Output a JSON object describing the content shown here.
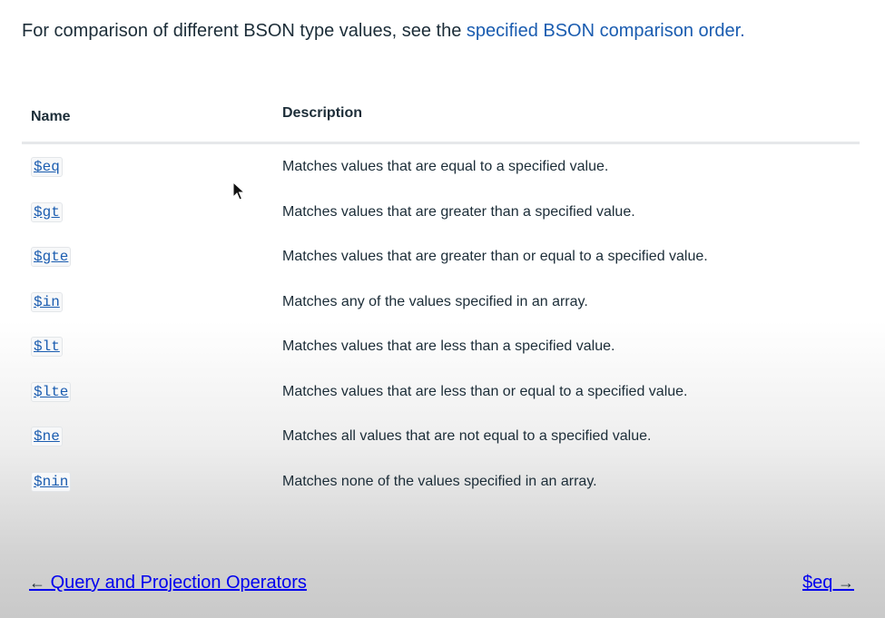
{
  "intro": {
    "text": "For comparison of different BSON type values, see the ",
    "link": "specified BSON comparison order."
  },
  "table": {
    "headers": {
      "name": "Name",
      "description": "Description"
    },
    "rows": [
      {
        "name": "$eq",
        "description": "Matches values that are equal to a specified value."
      },
      {
        "name": "$gt",
        "description": "Matches values that are greater than a specified value."
      },
      {
        "name": "$gte",
        "description": "Matches values that are greater than or equal to a specified value."
      },
      {
        "name": "$in",
        "description": "Matches any of the values specified in an array."
      },
      {
        "name": "$lt",
        "description": "Matches values that are less than a specified value."
      },
      {
        "name": "$lte",
        "description": "Matches values that are less than or equal to a specified value."
      },
      {
        "name": "$ne",
        "description": "Matches all values that are not equal to a specified value."
      },
      {
        "name": "$nin",
        "description": "Matches none of the values specified in an array."
      }
    ]
  },
  "nav": {
    "prev_arrow": "←",
    "prev_label": "Query and Projection Operators",
    "next_label": "$eq",
    "next_arrow": "→"
  },
  "icons": {
    "cursor": "mouse-pointer-icon"
  },
  "colors": {
    "link": "#1a5cb0",
    "text": "#1c2d38"
  }
}
